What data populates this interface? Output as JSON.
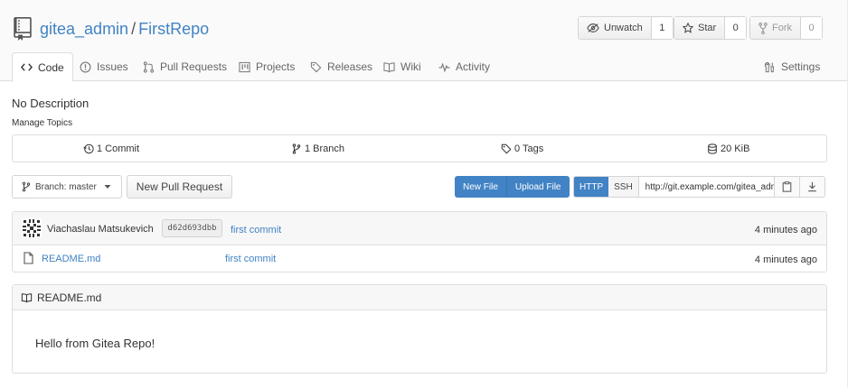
{
  "repo": {
    "owner": "gitea_admin",
    "separator": "/",
    "name": "FirstRepo"
  },
  "actions": {
    "watch": {
      "label": "Unwatch",
      "count": "1"
    },
    "star": {
      "label": "Star",
      "count": "0"
    },
    "fork": {
      "label": "Fork",
      "count": "0"
    }
  },
  "tabs": [
    {
      "label": "Code",
      "icon": "code-icon"
    },
    {
      "label": "Issues",
      "icon": "issue-icon"
    },
    {
      "label": "Pull Requests",
      "icon": "pull-request-icon"
    },
    {
      "label": "Projects",
      "icon": "project-icon"
    },
    {
      "label": "Releases",
      "icon": "tag-icon"
    },
    {
      "label": "Wiki",
      "icon": "book-icon"
    },
    {
      "label": "Activity",
      "icon": "pulse-icon"
    },
    {
      "label": "Settings",
      "icon": "tools-icon"
    }
  ],
  "description": "No Description",
  "manage_topics": "Manage Topics",
  "stats": {
    "commits": "1 Commit",
    "branches": "1 Branch",
    "tags": "0 Tags",
    "size": "20 KiB"
  },
  "toolbar": {
    "branch_label": "Branch: master",
    "new_pr": "New Pull Request",
    "new_file": "New File",
    "upload_file": "Upload File",
    "http": "HTTP",
    "ssh": "SSH",
    "clone_url": "http://git.example.com/gitea_adr"
  },
  "latest_commit": {
    "author": "Viachaslau Matsukevich",
    "sha": "d62d693dbb",
    "message": "first commit",
    "time": "4 minutes ago"
  },
  "files": [
    {
      "name": "README.md",
      "commit": "first commit",
      "time": "4 minutes ago"
    }
  ],
  "readme": {
    "title": "README.md",
    "content": "Hello from Gitea Repo!"
  },
  "colors": {
    "link": "#4183c4",
    "primary_button": "#4183c4"
  }
}
